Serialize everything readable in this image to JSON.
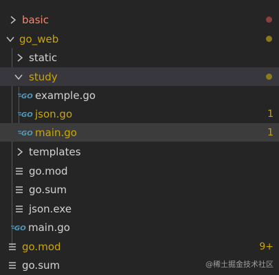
{
  "colors": {
    "background": "#252526",
    "selected_row": "#37373d",
    "text_default": "#d4d4d4",
    "text_error": "#f48771",
    "text_modified": "#cca700",
    "go_icon": "#519aba",
    "dot_red": "#8c3f3f",
    "dot_yellow": "#8a7a1c"
  },
  "explorer": {
    "items": [
      {
        "label": "basic",
        "type": "folder",
        "expanded": false
      },
      {
        "label": "go_web",
        "type": "folder",
        "expanded": true
      },
      {
        "label": "static",
        "type": "folder",
        "expanded": false
      },
      {
        "label": "study",
        "type": "folder",
        "expanded": true
      },
      {
        "label": "example.go",
        "type": "go-file"
      },
      {
        "label": "json.go",
        "type": "go-file",
        "badge": "1"
      },
      {
        "label": "main.go",
        "type": "go-file",
        "badge": "1",
        "selected": true
      },
      {
        "label": "templates",
        "type": "folder",
        "expanded": false
      },
      {
        "label": "go.mod",
        "type": "file"
      },
      {
        "label": "go.sum",
        "type": "file"
      },
      {
        "label": "json.exe",
        "type": "file"
      },
      {
        "label": "main.go",
        "type": "go-file"
      },
      {
        "label": "go.mod",
        "type": "file",
        "badge": "9+"
      },
      {
        "label": "go.sum",
        "type": "file"
      }
    ]
  },
  "icons": {
    "go_icon_text": "GO"
  },
  "watermark": "@稀土掘金技术社区"
}
